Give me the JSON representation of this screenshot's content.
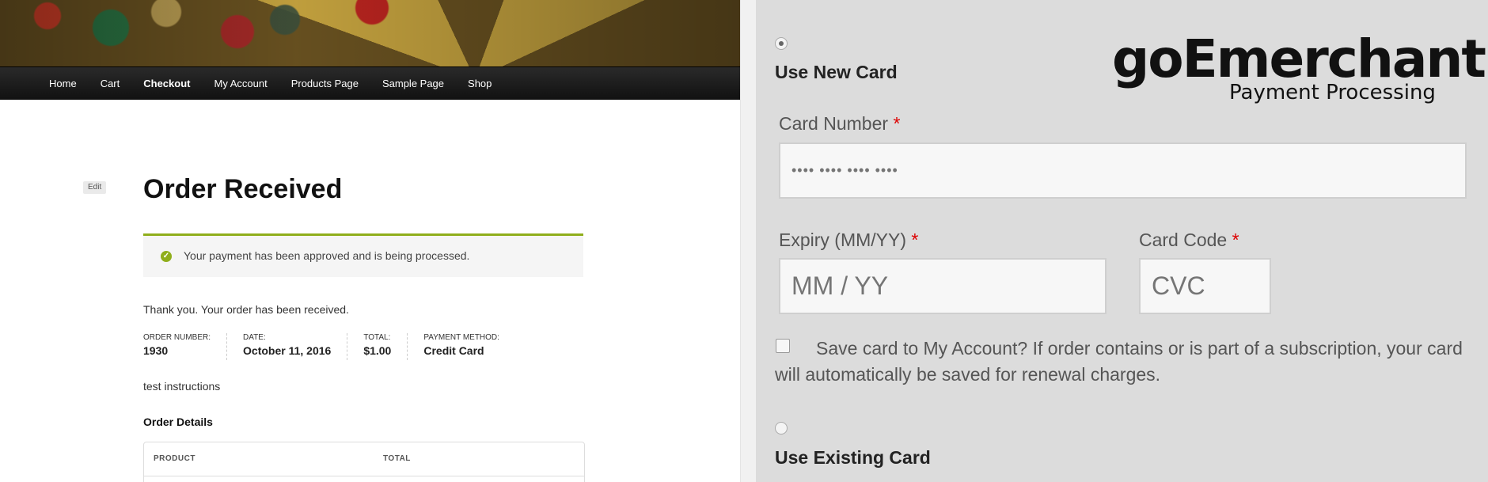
{
  "nav": {
    "items": [
      "Home",
      "Cart",
      "Checkout",
      "My Account",
      "Products Page",
      "Sample Page",
      "Shop"
    ],
    "active": "Checkout"
  },
  "page": {
    "edit": "Edit",
    "title": "Order Received",
    "notice": "Your payment has been approved and is being processed.",
    "thanks": "Thank you. Your order has been received.",
    "instructions": "test instructions",
    "details_title": "Order Details"
  },
  "overview": {
    "order_number_label": "ORDER NUMBER:",
    "order_number": "1930",
    "date_label": "DATE:",
    "date": "October 11, 2016",
    "total_label": "TOTAL:",
    "total": "$1.00",
    "method_label": "PAYMENT METHOD:",
    "method": "Credit Card"
  },
  "table": {
    "headers": [
      "PRODUCT",
      "TOTAL"
    ]
  },
  "payment": {
    "use_new_card": "Use New Card",
    "use_existing_card": "Use Existing Card",
    "card_number_label": "Card Number",
    "card_number_placeholder": "•••• •••• •••• ••••",
    "expiry_label": "Expiry (MM/YY)",
    "expiry_placeholder": "MM / YY",
    "card_code_label": "Card Code",
    "card_code_placeholder": "CVC",
    "required_mark": "*",
    "save_card_text": "Save card to My Account? If order contains or is part of a subscription, your card will automatically be saved for renewal charges."
  },
  "logo": {
    "brand": "goEmerchant",
    "sub": "Payment Processing"
  },
  "colors": {
    "success": "#8fae1b",
    "required": "#dd0000",
    "panel": "#dcdcdc"
  }
}
